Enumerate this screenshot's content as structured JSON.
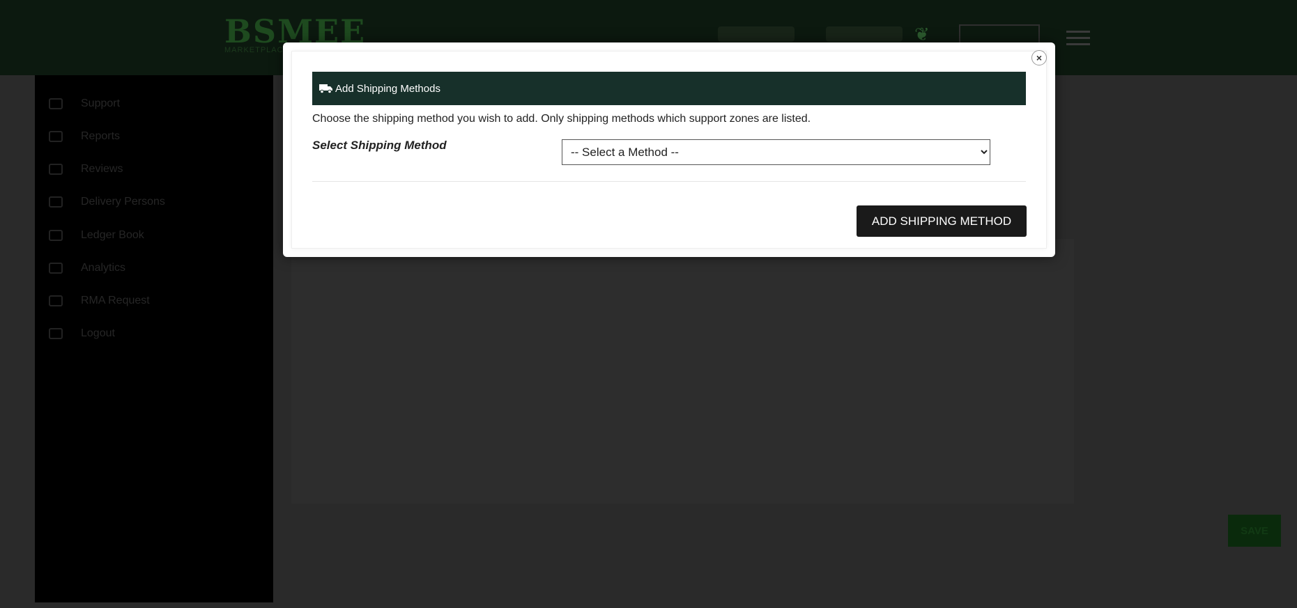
{
  "header": {
    "logo_text": "BSMEE",
    "logo_subtext": "MARKETPLACE"
  },
  "sidebar": {
    "items": [
      {
        "label": "Support",
        "icon": "support-icon"
      },
      {
        "label": "Reports",
        "icon": "reports-icon"
      },
      {
        "label": "Reviews",
        "icon": "reviews-icon"
      },
      {
        "label": "Delivery Persons",
        "icon": "delivery-icon"
      },
      {
        "label": "Ledger Book",
        "icon": "ledger-icon"
      },
      {
        "label": "Analytics",
        "icon": "analytics-icon"
      },
      {
        "label": "RMA Request",
        "icon": "rma-icon"
      },
      {
        "label": "Logout",
        "icon": "logout-icon"
      }
    ]
  },
  "page": {
    "save_label": "SAVE"
  },
  "modal": {
    "title": "Add Shipping Methods",
    "description": "Choose the shipping method you wish to add. Only shipping methods which support zones are listed.",
    "field_label": "Select Shipping Method",
    "select_value": "-- Select a Method --",
    "submit_label": "ADD SHIPPING METHOD",
    "close_glyph": "×"
  },
  "colors": {
    "header_bg": "#17302a",
    "button_bg": "#1a1a1a",
    "brand_green": "#1e4a1f"
  }
}
